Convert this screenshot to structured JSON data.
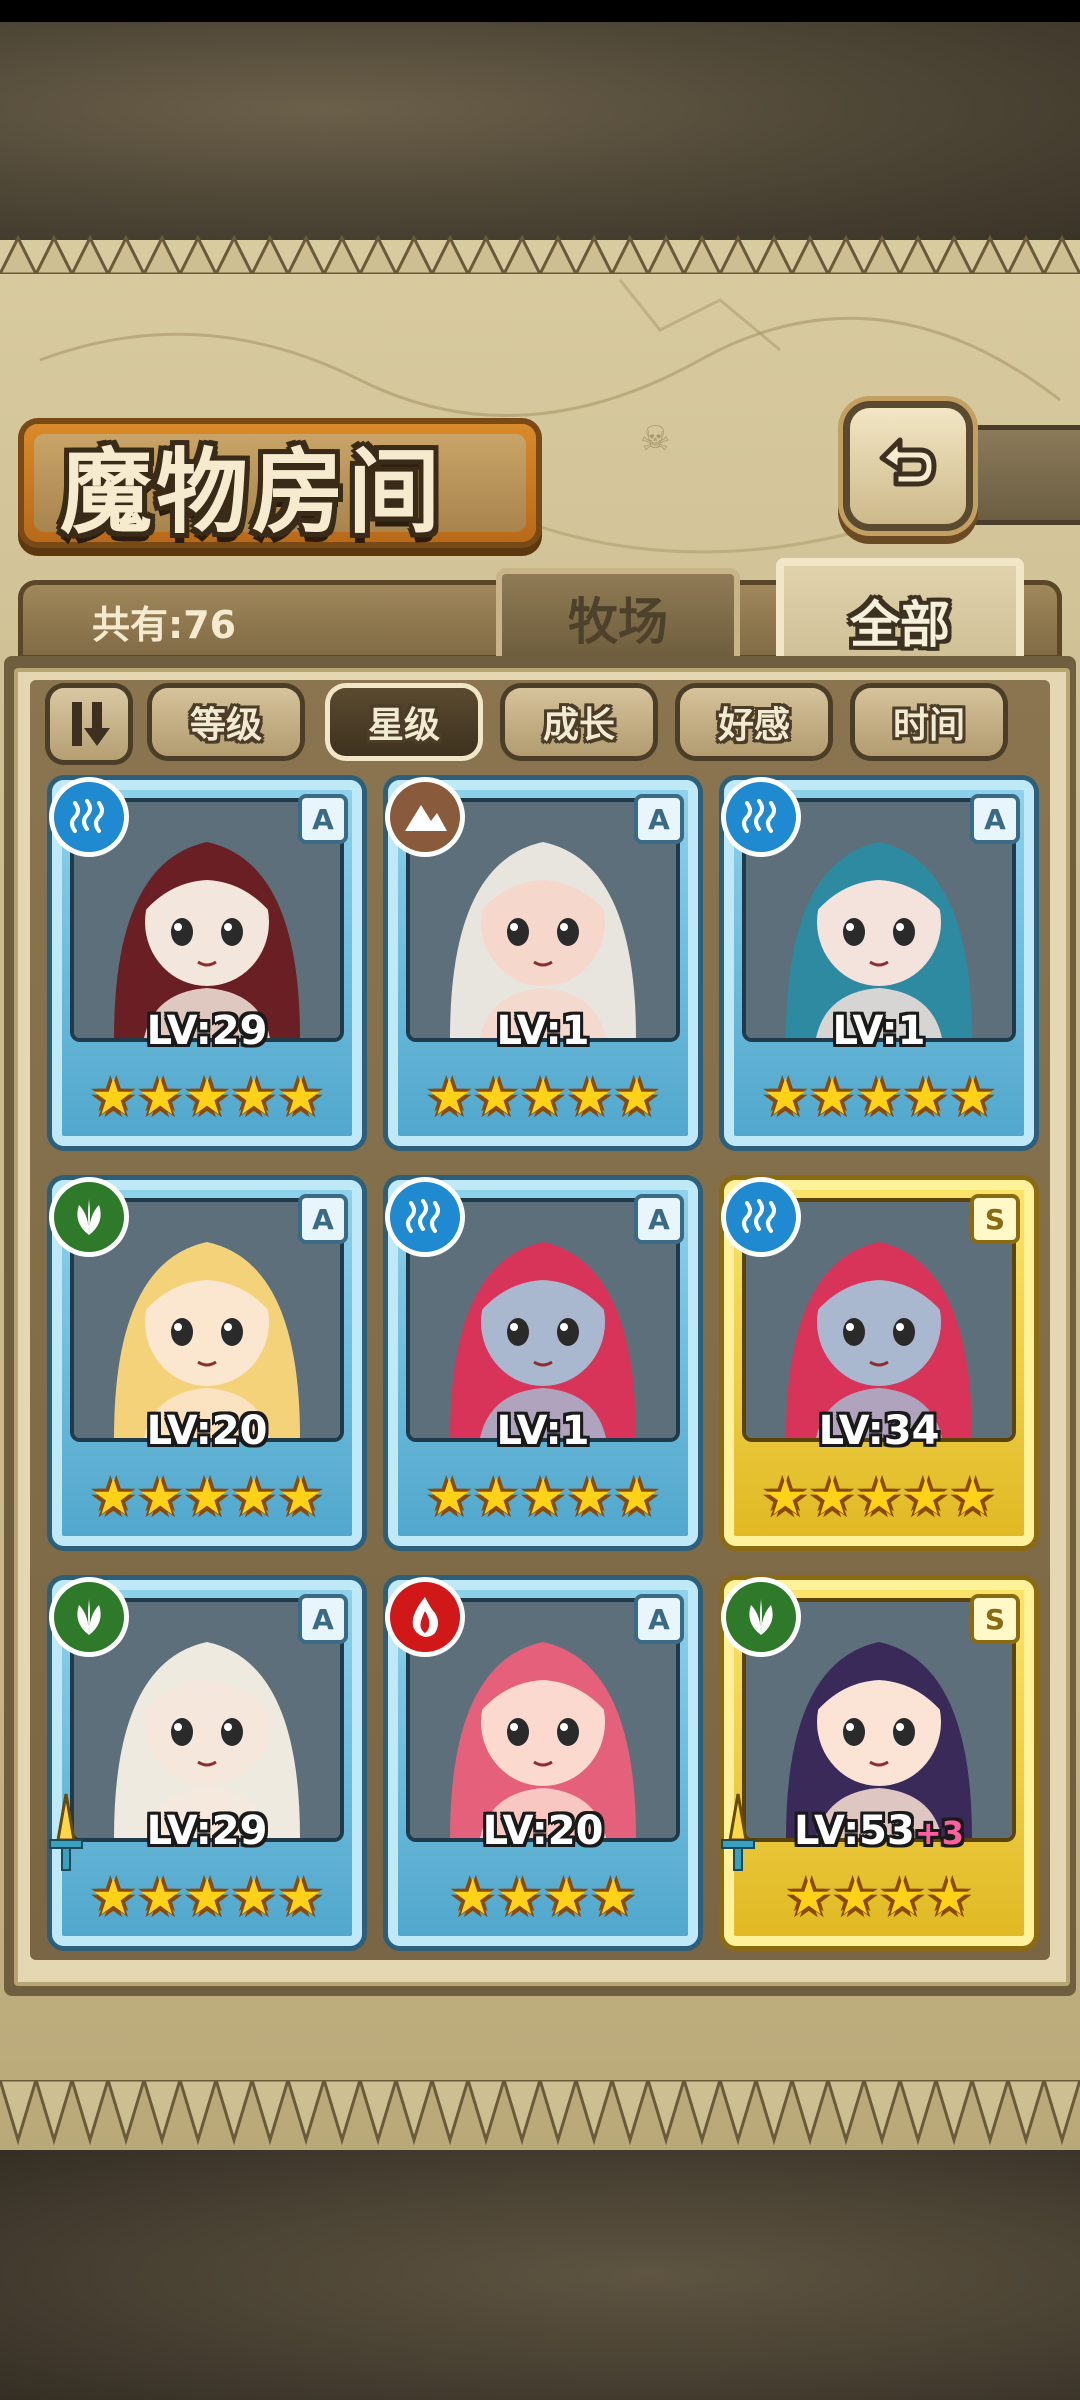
{
  "header": {
    "title": "魔物房间",
    "back_button_icon": "back-arrow-icon"
  },
  "tabs": {
    "count_label": "共有:76",
    "ranch_label": "牧场",
    "all_label": "全部",
    "active_tab": "全部"
  },
  "sort": {
    "toggle_icon": "sort-order-icon",
    "buttons": [
      {
        "label": "等级",
        "active": false
      },
      {
        "label": "星级",
        "active": true
      },
      {
        "label": "成长",
        "active": false
      },
      {
        "label": "好感",
        "active": false
      },
      {
        "label": "时间",
        "active": false
      }
    ]
  },
  "monsters": [
    {
      "level": "LV:29",
      "bonus": "",
      "rank": "A",
      "element": "water",
      "stars": 5,
      "frame": "blue",
      "weapon": false,
      "portrait_colors": [
        "#6a1f24",
        "#f3e6dc"
      ]
    },
    {
      "level": "LV:1",
      "bonus": "",
      "rank": "A",
      "element": "earth",
      "stars": 5,
      "frame": "blue",
      "weapon": false,
      "portrait_colors": [
        "#e8e4de",
        "#f6d7cc"
      ]
    },
    {
      "level": "LV:1",
      "bonus": "",
      "rank": "A",
      "element": "water",
      "stars": 5,
      "frame": "blue",
      "weapon": false,
      "portrait_colors": [
        "#2e8aa0",
        "#f4e2dc"
      ]
    },
    {
      "level": "LV:20",
      "bonus": "",
      "rank": "A",
      "element": "wood",
      "stars": 5,
      "frame": "blue",
      "weapon": false,
      "portrait_colors": [
        "#f3d27a",
        "#fbe6cf"
      ]
    },
    {
      "level": "LV:1",
      "bonus": "",
      "rank": "A",
      "element": "water",
      "stars": 5,
      "frame": "blue",
      "weapon": false,
      "portrait_colors": [
        "#d8345a",
        "#a9b7cf"
      ]
    },
    {
      "level": "LV:34",
      "bonus": "",
      "rank": "S",
      "element": "water",
      "stars": 5,
      "frame": "gold",
      "weapon": false,
      "portrait_colors": [
        "#d8345a",
        "#a9b7cf"
      ]
    },
    {
      "level": "LV:29",
      "bonus": "",
      "rank": "A",
      "element": "wood",
      "stars": 5,
      "frame": "blue",
      "weapon": true,
      "portrait_colors": [
        "#eeeae0",
        "#f6e7dc"
      ]
    },
    {
      "level": "LV:20",
      "bonus": "",
      "rank": "A",
      "element": "fire",
      "stars": 4,
      "frame": "blue",
      "weapon": false,
      "portrait_colors": [
        "#e5607a",
        "#fbd9cf"
      ]
    },
    {
      "level": "LV:53",
      "bonus": "+3",
      "rank": "S",
      "element": "wood",
      "stars": 4,
      "frame": "gold",
      "weapon": true,
      "portrait_colors": [
        "#3a2a5a",
        "#fbe3d6"
      ]
    }
  ],
  "colors": {
    "water": "#1f8ad0",
    "earth": "#8a5a3c",
    "wood": "#2f7a2a",
    "fire": "#d01818",
    "star": "#ffd21a"
  }
}
